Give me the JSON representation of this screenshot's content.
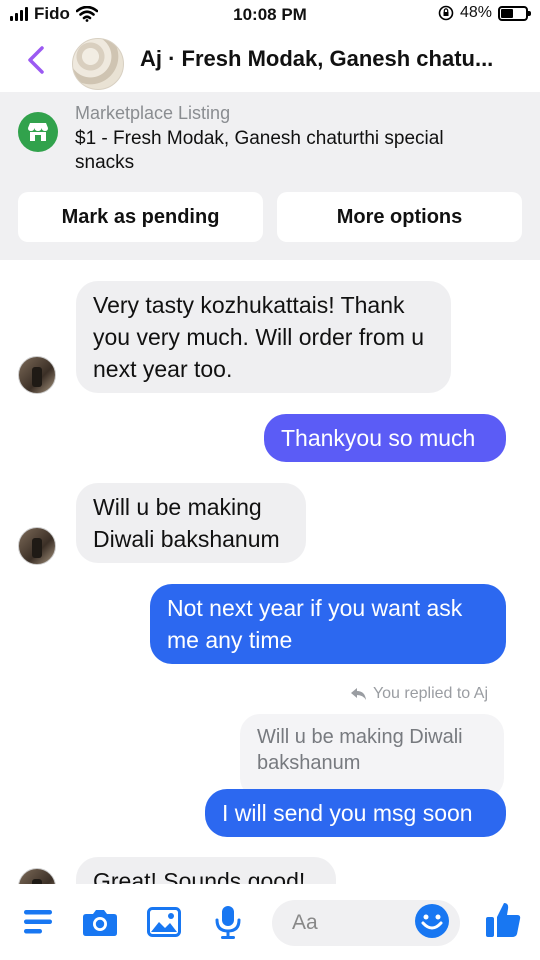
{
  "status": {
    "carrier": "Fido",
    "time": "10:08 PM",
    "battery": "48%"
  },
  "header": {
    "title": "Aj · Fresh Modak, Ganesh chatu..."
  },
  "listing": {
    "label": "Marketplace Listing",
    "title": "$1 - Fresh Modak, Ganesh chaturthi special snacks",
    "pending_button": "Mark as pending",
    "options_button": "More options"
  },
  "messages": [
    {
      "from": "them",
      "text": "Very tasty kozhukattais! Thank you very much. Will order from u next year too."
    },
    {
      "from": "me",
      "text": "Thankyou so much"
    },
    {
      "from": "them",
      "text": "Will u be making Diwali bakshanum"
    },
    {
      "from": "me",
      "text": "Not next year if you want ask me any time"
    },
    {
      "from": "me",
      "text": "I will send you msg soon"
    },
    {
      "from": "them",
      "text": "Great! Sounds good!"
    }
  ],
  "reply": {
    "note": "You replied to Aj",
    "quoted": "Will u be making Diwali bakshanum"
  },
  "composer": {
    "placeholder": "Aa"
  },
  "colors": {
    "accent": "#5b5cf6",
    "accent_blue": "#2c68f0",
    "marketplace_green": "#31a24c",
    "back_purple": "#9b59f2"
  }
}
